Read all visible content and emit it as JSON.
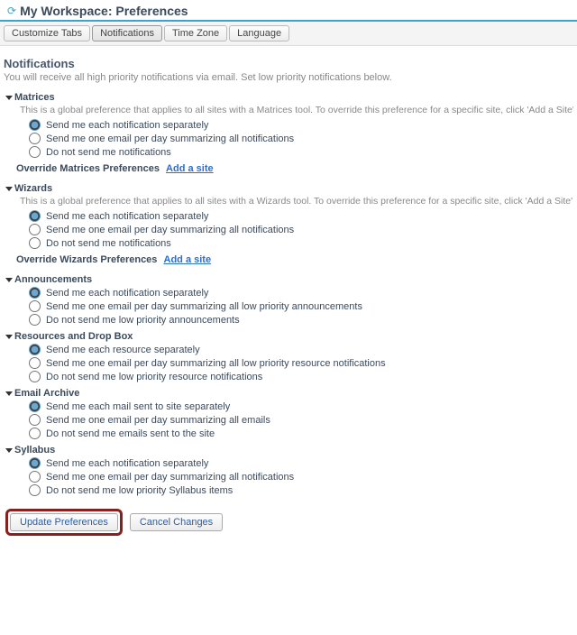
{
  "header": {
    "title": "My Workspace: Preferences"
  },
  "tabs": [
    {
      "label": "Customize Tabs"
    },
    {
      "label": "Notifications"
    },
    {
      "label": "Time Zone"
    },
    {
      "label": "Language"
    }
  ],
  "page": {
    "heading": "Notifications",
    "desc": "You will receive all high priority notifications via email. Set low priority notifications below."
  },
  "sections": {
    "matrices": {
      "title": "Matrices",
      "desc": "This is a global preference that applies to all sites with a Matrices tool. To override this preference for a specific site, click 'Add a Site'.",
      "options": [
        "Send me each notification separately",
        "Send me one email per day summarizing all notifications",
        "Do not send me notifications"
      ],
      "override_label": "Override Matrices Preferences",
      "add_site": "Add a site"
    },
    "wizards": {
      "title": "Wizards",
      "desc": "This is a global preference that applies to all sites with a Wizards tool. To override this preference for a specific site, click 'Add a Site'.",
      "options": [
        "Send me each notification separately",
        "Send me one email per day summarizing all notifications",
        "Do not send me notifications"
      ],
      "override_label": "Override Wizards Preferences",
      "add_site": "Add a site"
    },
    "announcements": {
      "title": "Announcements",
      "options": [
        "Send me each notification separately",
        "Send me one email per day summarizing all low priority announcements",
        "Do not send me low priority announcements"
      ]
    },
    "resources": {
      "title": "Resources and Drop Box",
      "options": [
        "Send me each resource separately",
        "Send me one email per day summarizing all low priority resource notifications",
        "Do not send me low priority resource notifications"
      ]
    },
    "email": {
      "title": "Email Archive",
      "options": [
        "Send me each mail sent to site separately",
        "Send me one email per day summarizing all emails",
        "Do not send me emails sent to the site"
      ]
    },
    "syllabus": {
      "title": "Syllabus",
      "options": [
        "Send me each notification separately",
        "Send me one email per day summarizing all notifications",
        "Do not send me low priority Syllabus items"
      ]
    }
  },
  "actions": {
    "update": "Update Preferences",
    "cancel": "Cancel Changes"
  }
}
